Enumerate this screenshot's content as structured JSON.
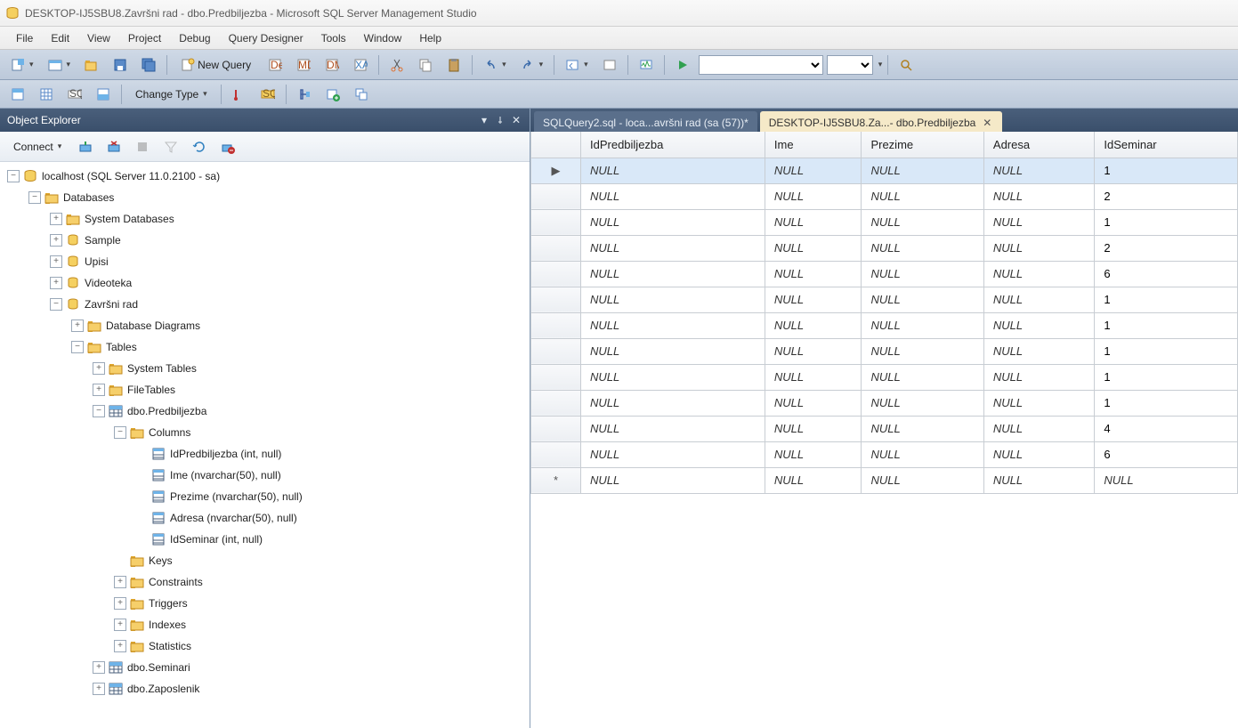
{
  "title": "DESKTOP-IJ5SBU8.Završni rad - dbo.Predbiljezba - Microsoft SQL Server Management Studio",
  "menu": [
    "File",
    "Edit",
    "View",
    "Project",
    "Debug",
    "Query Designer",
    "Tools",
    "Window",
    "Help"
  ],
  "toolbar": {
    "new_query": "New Query"
  },
  "toolbar2": {
    "change_type": "Change Type"
  },
  "oe": {
    "title": "Object Explorer",
    "connect": "Connect",
    "root": "localhost (SQL Server 11.0.2100 - sa)",
    "databases": "Databases",
    "nodes": {
      "system_db": "System Databases",
      "sample": "Sample",
      "upisi": "Upisi",
      "videoteka": "Videoteka",
      "zavrsni": "Završni rad",
      "db_diagrams": "Database Diagrams",
      "tables": "Tables",
      "sys_tables": "System Tables",
      "filetables": "FileTables",
      "predbiljezba": "dbo.Predbiljezba",
      "columns": "Columns",
      "col_id": "IdPredbiljezba (int, null)",
      "col_ime": "Ime (nvarchar(50), null)",
      "col_prezime": "Prezime (nvarchar(50), null)",
      "col_adresa": "Adresa (nvarchar(50), null)",
      "col_idsem": "IdSeminar (int, null)",
      "keys": "Keys",
      "constraints": "Constraints",
      "triggers": "Triggers",
      "indexes": "Indexes",
      "statistics": "Statistics",
      "seminari": "dbo.Seminari",
      "zaposlenik": "dbo.Zaposlenik"
    }
  },
  "tabs": [
    {
      "label": "SQLQuery2.sql - loca...avršni rad (sa (57))*",
      "active": false,
      "closeable": false
    },
    {
      "label": "DESKTOP-IJ5SBU8.Za...- dbo.Predbiljezba",
      "active": true,
      "closeable": true
    }
  ],
  "grid": {
    "headers": [
      "IdPredbiljezba",
      "Ime",
      "Prezime",
      "Adresa",
      "IdSeminar"
    ],
    "null_text": "NULL",
    "row_indicator": "▶",
    "new_row": "*",
    "rows": [
      {
        "selected": true,
        "indicator": "▶",
        "cells": [
          "NULL",
          "NULL",
          "NULL",
          "NULL",
          "1"
        ]
      },
      {
        "selected": false,
        "indicator": "",
        "cells": [
          "NULL",
          "NULL",
          "NULL",
          "NULL",
          "2"
        ]
      },
      {
        "selected": false,
        "indicator": "",
        "cells": [
          "NULL",
          "NULL",
          "NULL",
          "NULL",
          "1"
        ]
      },
      {
        "selected": false,
        "indicator": "",
        "cells": [
          "NULL",
          "NULL",
          "NULL",
          "NULL",
          "2"
        ]
      },
      {
        "selected": false,
        "indicator": "",
        "cells": [
          "NULL",
          "NULL",
          "NULL",
          "NULL",
          "6"
        ]
      },
      {
        "selected": false,
        "indicator": "",
        "cells": [
          "NULL",
          "NULL",
          "NULL",
          "NULL",
          "1"
        ]
      },
      {
        "selected": false,
        "indicator": "",
        "cells": [
          "NULL",
          "NULL",
          "NULL",
          "NULL",
          "1"
        ]
      },
      {
        "selected": false,
        "indicator": "",
        "cells": [
          "NULL",
          "NULL",
          "NULL",
          "NULL",
          "1"
        ]
      },
      {
        "selected": false,
        "indicator": "",
        "cells": [
          "NULL",
          "NULL",
          "NULL",
          "NULL",
          "1"
        ]
      },
      {
        "selected": false,
        "indicator": "",
        "cells": [
          "NULL",
          "NULL",
          "NULL",
          "NULL",
          "1"
        ]
      },
      {
        "selected": false,
        "indicator": "",
        "cells": [
          "NULL",
          "NULL",
          "NULL",
          "NULL",
          "4"
        ]
      },
      {
        "selected": false,
        "indicator": "",
        "cells": [
          "NULL",
          "NULL",
          "NULL",
          "NULL",
          "6"
        ]
      },
      {
        "selected": false,
        "indicator": "*",
        "cells": [
          "NULL",
          "NULL",
          "NULL",
          "NULL",
          "NULL"
        ]
      }
    ]
  }
}
